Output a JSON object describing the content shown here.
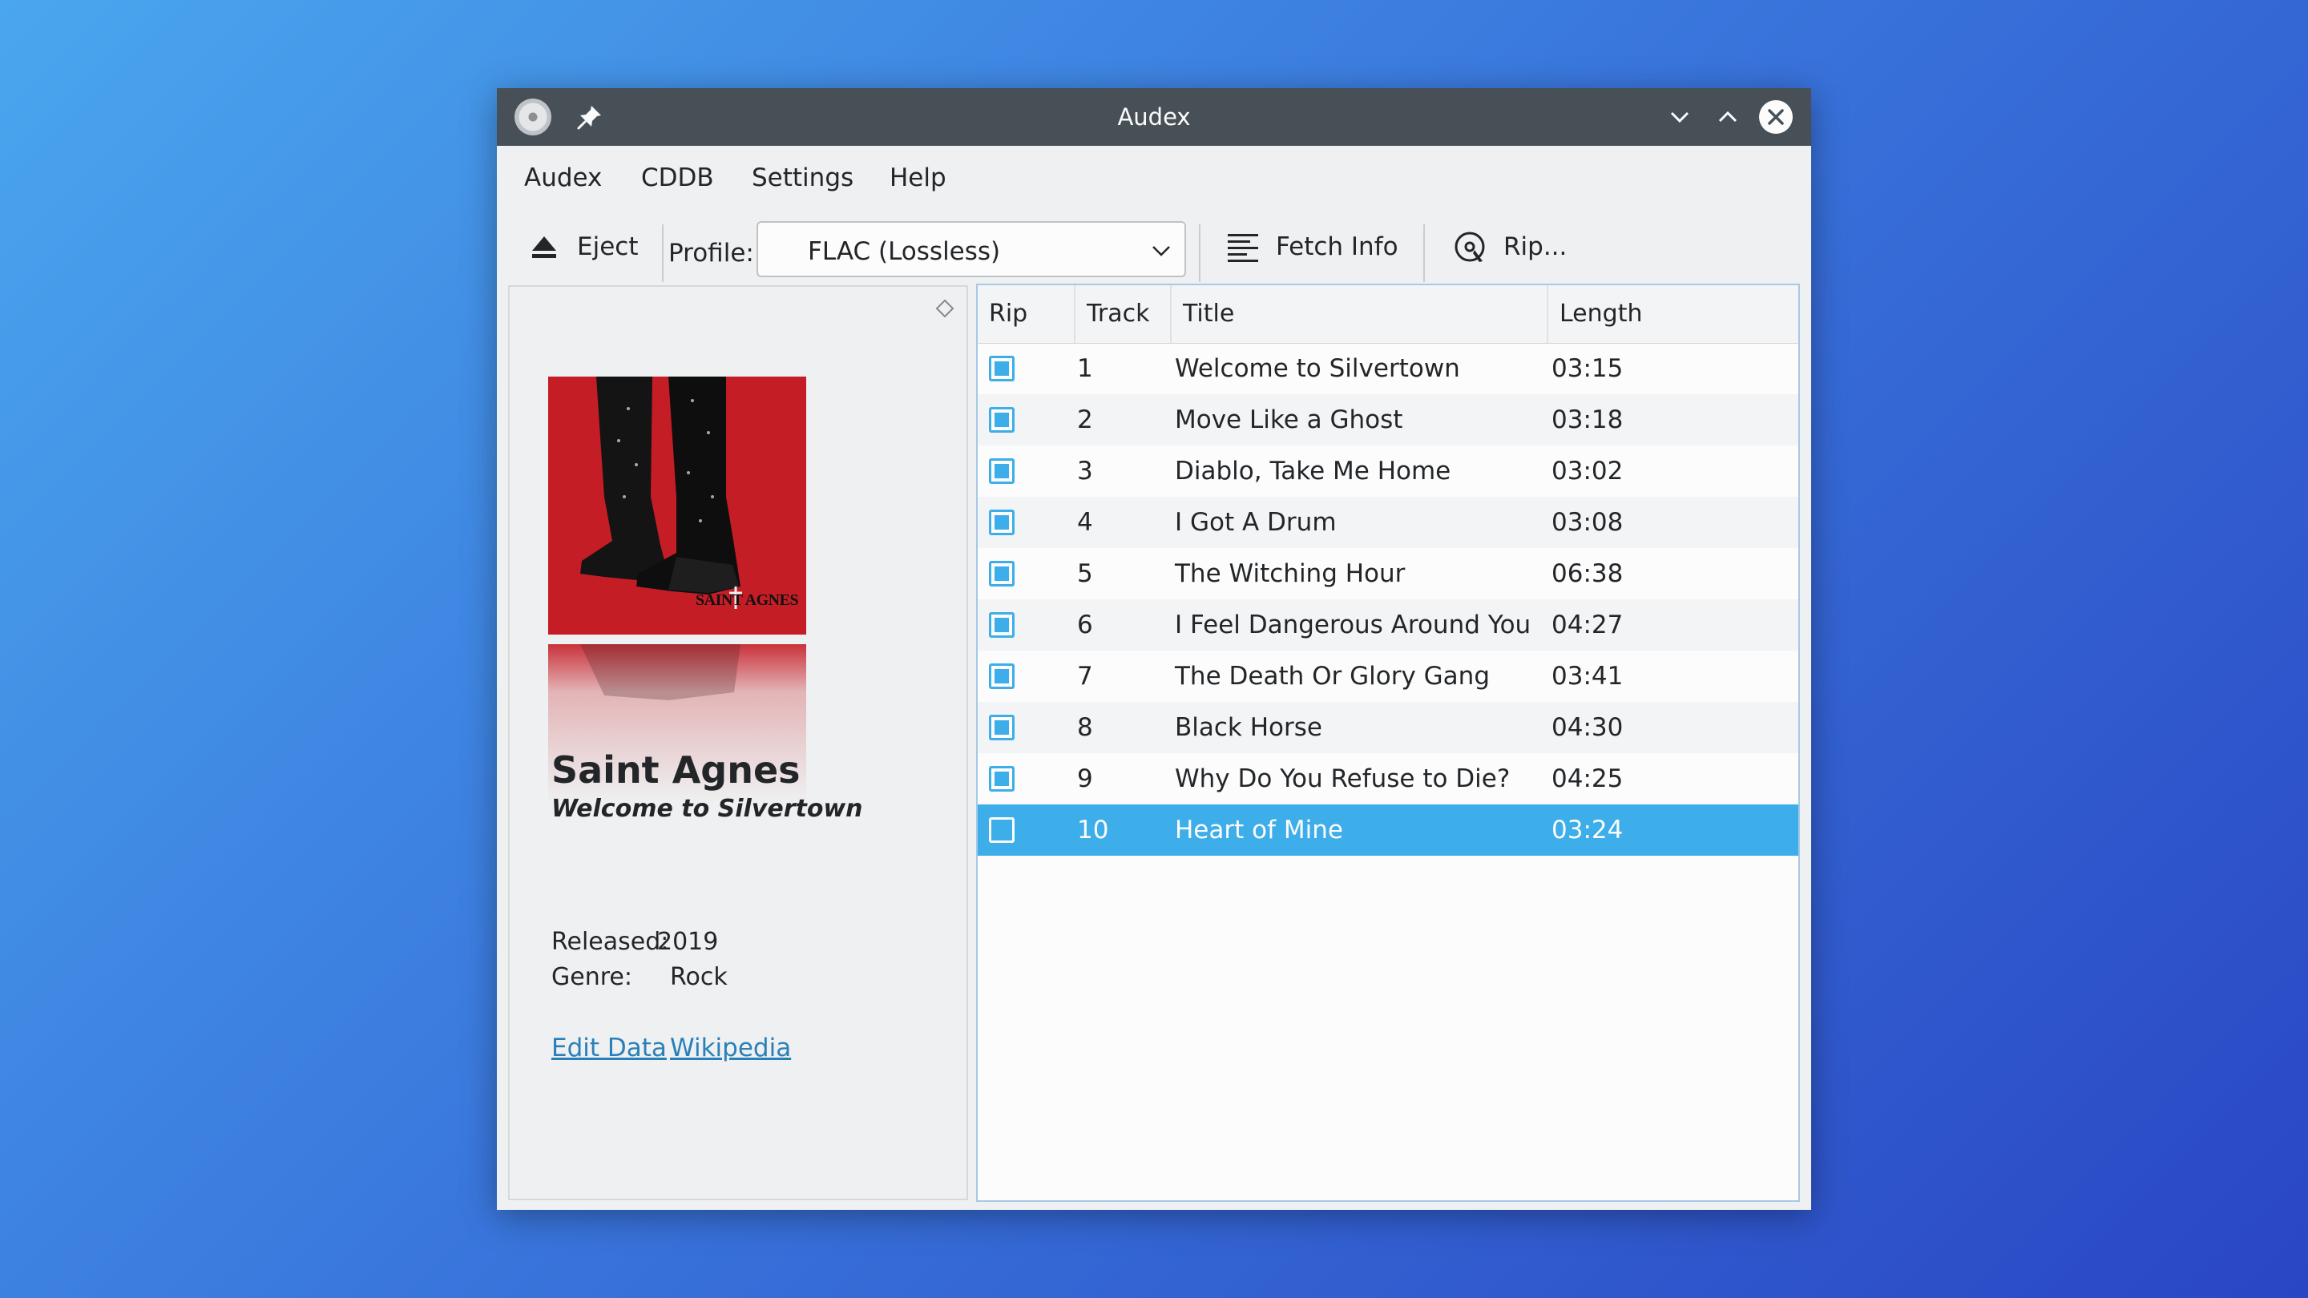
{
  "window": {
    "title": "Audex"
  },
  "menu": {
    "items": [
      "Audex",
      "CDDB",
      "Settings",
      "Help"
    ]
  },
  "toolbar": {
    "eject_label": "Eject",
    "profile_label": "Profile:",
    "profile_value": "FLAC (Lossless)",
    "fetch_label": "Fetch Info",
    "rip_label": "Rip..."
  },
  "album": {
    "artist": "Saint Agnes",
    "title": "Welcome to Silvertown",
    "released_label": "Released:",
    "released_value": "2019",
    "genre_label": "Genre:",
    "genre_value": "Rock",
    "cover_text": "SAINT AGNES",
    "edit_link": "Edit Data",
    "wiki_link": "Wikipedia"
  },
  "tracks": {
    "columns": [
      "Rip",
      "Track",
      "Title",
      "Length"
    ],
    "rows": [
      {
        "rip": true,
        "track": "1",
        "title": "Welcome to Silvertown",
        "length": "03:15"
      },
      {
        "rip": true,
        "track": "2",
        "title": "Move Like a Ghost",
        "length": "03:18"
      },
      {
        "rip": true,
        "track": "3",
        "title": "Diablo, Take Me Home",
        "length": "03:02"
      },
      {
        "rip": true,
        "track": "4",
        "title": "I Got A Drum",
        "length": "03:08"
      },
      {
        "rip": true,
        "track": "5",
        "title": "The Witching Hour",
        "length": "06:38"
      },
      {
        "rip": true,
        "track": "6",
        "title": "I Feel Dangerous Around You",
        "length": "04:27"
      },
      {
        "rip": true,
        "track": "7",
        "title": "The Death Or Glory Gang",
        "length": "03:41"
      },
      {
        "rip": true,
        "track": "8",
        "title": "Black Horse",
        "length": "04:30"
      },
      {
        "rip": true,
        "track": "9",
        "title": "Why Do You Refuse to Die?",
        "length": "04:25"
      },
      {
        "rip": false,
        "track": "10",
        "title": "Heart of Mine",
        "length": "03:24",
        "selected": true
      }
    ]
  },
  "colors": {
    "accent": "#3daee9",
    "titlebar": "#475057",
    "link": "#2980b9",
    "cover_red": "#c51d26"
  },
  "icons": [
    "app-cd-icon",
    "pin-icon",
    "minimize-icon",
    "maximize-icon",
    "close-icon",
    "eject-icon",
    "fetch-info-icon",
    "rip-icon",
    "dock-float-icon",
    "chevron-down-icon"
  ]
}
